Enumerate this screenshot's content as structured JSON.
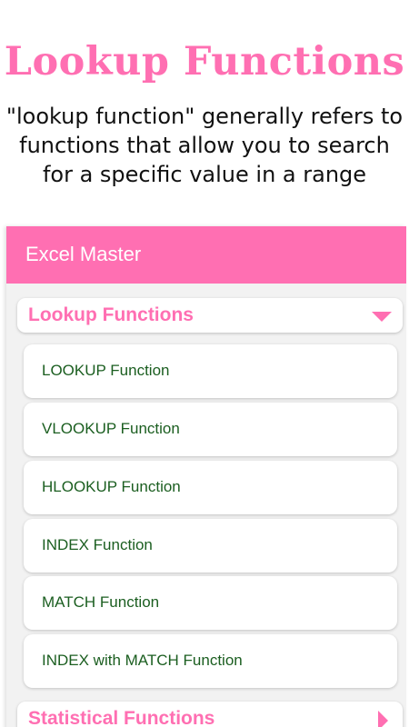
{
  "hero": {
    "title": "Lookup Functions",
    "description": "\"lookup function\" generally refers to functions that allow you to search for a specific value in a range"
  },
  "app_bar": {
    "title": "Excel Master"
  },
  "colors": {
    "accent": "#ff6fb2",
    "item_text": "#1b5e20",
    "panel_background": "#f2f2f2"
  },
  "categories": [
    {
      "label": "Lookup Functions",
      "expanded": true,
      "icon": "caret-down-icon",
      "items": [
        "LOOKUP Function",
        "VLOOKUP Function",
        "HLOOKUP Function",
        "INDEX Function",
        "MATCH Function",
        "INDEX with MATCH Function"
      ]
    },
    {
      "label": "Statistical Functions",
      "expanded": false,
      "icon": "caret-right-icon",
      "items": []
    }
  ]
}
